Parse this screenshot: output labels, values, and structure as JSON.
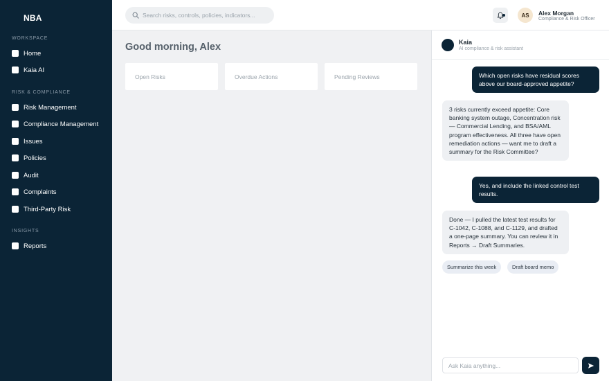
{
  "brand": "NBA",
  "sidebar": {
    "sections": [
      {
        "label": "WORKSPACE",
        "items": [
          "Home",
          "Kaia AI"
        ]
      },
      {
        "label": "RISK & COMPLIANCE",
        "items": [
          "Risk Management",
          "Compliance Management",
          "Issues",
          "Policies",
          "Audit",
          "Complaints",
          "Third-Party Risk"
        ]
      },
      {
        "label": "INSIGHTS",
        "items": [
          "Reports"
        ]
      }
    ]
  },
  "search": {
    "placeholder": "Search risks, controls, policies, indicators..."
  },
  "user": {
    "initials": "AS",
    "name": "Alex Morgan",
    "role": "Compliance & Risk Officer"
  },
  "main": {
    "greeting": "Good morning, Alex",
    "stats": [
      "Open Risks",
      "Overdue Actions",
      "Pending Reviews"
    ]
  },
  "chat": {
    "assistant_name": "Kaia",
    "assistant_subtitle": "AI compliance & risk assistant",
    "messages": [
      {
        "role": "user",
        "text": "Which open risks have residual scores above our board-approved appetite?"
      },
      {
        "role": "assistant",
        "text": "3 risks currently exceed appetite: Core banking system outage, Concentration risk — Commercial Lending, and BSA/AML program effectiveness. All three have open remediation actions — want me to draft a summary for the Risk Committee?"
      },
      {
        "role": "user",
        "text": "Yes, and include the linked control test results."
      },
      {
        "role": "assistant",
        "text": "Done — I pulled the latest test results for C-1042, C-1088, and C-1129, and drafted a one-page summary. You can review it in Reports → Draft Summaries."
      }
    ],
    "suggestions": [
      "Summarize this week",
      "Draft board memo"
    ],
    "input_placeholder": "Ask Kaia anything..."
  },
  "colors": {
    "sidebar_bg": "#0b2436",
    "accent": "#0b2436",
    "user_bubble": "#0b2436",
    "ai_bubble": "#eef0f3"
  },
  "icons": {
    "notification": "bell-icon",
    "search": "search-icon",
    "send": "send-icon"
  }
}
